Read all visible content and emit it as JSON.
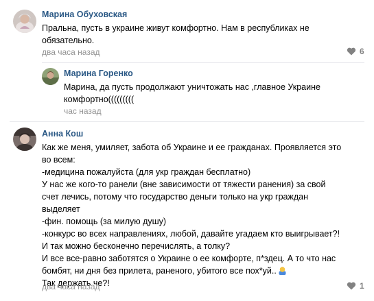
{
  "comments": [
    {
      "author": "Марина Обуховская",
      "text": "Пральна, пусть в украине живут комфортно. Нам в республиках не\nобязательно.",
      "time": "два часа назад",
      "likes": "6"
    },
    {
      "author": "Марина Горенко",
      "text": "Марина, да пусть продолжают уничтожать нас ,главное Украине\nкомфортно(((((((((",
      "time": "час назад"
    },
    {
      "author": "Анна Кош",
      "text": "Как же меня, умиляет, забота об Украине и ее гражданах. Проявляется это\nво всем:\n-медицина пожалуйста (для укр граждан бесплатно)\nУ нас же кого-то ранели (вне зависимости от тяжести ранения) за свой\nсчет лечись, потому что государство деньги только на укр граждан\nвыделяет\n-фин. помощь (за милую душу)\n-конкурс во всех направлениях, любой, давайте угадаем кто выигрывает?!\nИ так можно бесконечно перечислять, а толку?\nИ все все-равно заботятся о Украине о ее комфорте, п*здец. А то что нас\nбомбят, ни дня без прилета, раненого, убитого все пох*уй..",
      "text_end": "Так держать че?!",
      "time": "два часа назад",
      "likes": "1",
      "emoji": "person-shrugging-icon"
    }
  ],
  "colors": {
    "author": "#2a5885",
    "meta": "#939393",
    "divider": "#e7e8ec"
  }
}
